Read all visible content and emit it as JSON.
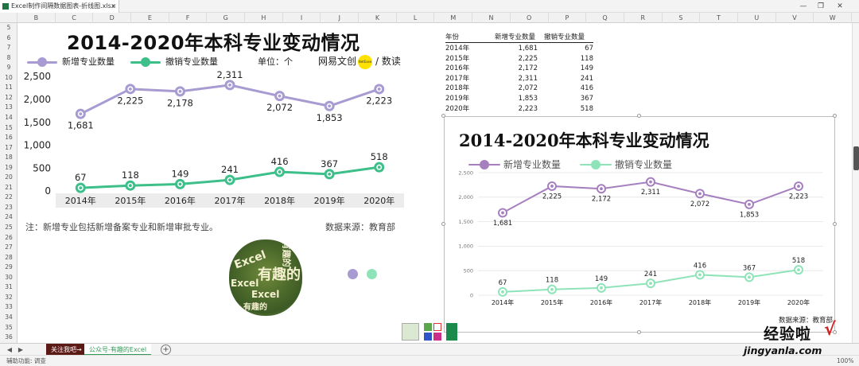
{
  "window": {
    "tab_title": "Excel制作间隔数据图表-折线图.xlsx",
    "tab_close": "×",
    "controls": {
      "minimize": "—",
      "restore": "❐",
      "close": "✕"
    }
  },
  "columns": [
    "B",
    "C",
    "D",
    "E",
    "F",
    "G",
    "H",
    "I",
    "J",
    "K",
    "L",
    "M",
    "N",
    "O",
    "P",
    "Q",
    "R",
    "S",
    "T",
    "U",
    "V",
    "W"
  ],
  "rows": [
    "5",
    "6",
    "7",
    "8",
    "9",
    "10",
    "11",
    "12",
    "13",
    "14",
    "15",
    "16",
    "17",
    "18",
    "19",
    "20",
    "21",
    "22",
    "23",
    "24",
    "25",
    "26",
    "27",
    "28",
    "29",
    "30",
    "31",
    "32",
    "33",
    "34",
    "35",
    "36"
  ],
  "left_chart": {
    "title": "2014-2020年本科专业变动情况",
    "legend": [
      {
        "label": "新增专业数量",
        "color": "#a79bd2"
      },
      {
        "label": "撤销专业数量",
        "color": "#3dbf8a"
      }
    ],
    "unit": "单位：个",
    "brand": {
      "text": "网易文创",
      "badge": "NetEase",
      "suffix": "/ 数读"
    },
    "note": "注：新增专业包括新增备案专业和新增审批专业。",
    "source": "数据来源：教育部"
  },
  "table": {
    "headers": [
      "年份",
      "新增专业数量",
      "撤销专业数量"
    ],
    "rows": [
      [
        "2014年",
        "1,681",
        "67"
      ],
      [
        "2015年",
        "2,225",
        "118"
      ],
      [
        "2016年",
        "2,172",
        "149"
      ],
      [
        "2017年",
        "2,311",
        "241"
      ],
      [
        "2018年",
        "2,072",
        "416"
      ],
      [
        "2019年",
        "1,853",
        "367"
      ],
      [
        "2020年",
        "2,223",
        "518"
      ]
    ]
  },
  "right_chart": {
    "title": "2014-2020年本科专业变动情况",
    "legend": [
      {
        "label": "新增专业数量",
        "color": "#a67fbf"
      },
      {
        "label": "撤销专业数量",
        "color": "#8fe3b8"
      }
    ],
    "source": "数据来源：教育部"
  },
  "word_cloud": {
    "words": [
      "Excel",
      "有趣的",
      "Excel",
      "有趣的",
      "Excel",
      "有趣的"
    ]
  },
  "sheets": [
    {
      "label": "关注我吧→",
      "active": false,
      "color": "#5b1a16"
    },
    {
      "label": "公众号-有趣的Excel",
      "active": true,
      "color": "#2f9a56"
    }
  ],
  "sheet_add": "+",
  "status": {
    "left": "辅助功能: 调查",
    "zoom": "100%"
  },
  "watermark": {
    "cn": "经验啦",
    "check": "√",
    "url": "jingyanla.com"
  },
  "chart_data": [
    {
      "type": "line",
      "title": "2014-2020年本科专业变动情况",
      "categories": [
        "2014年",
        "2015年",
        "2016年",
        "2017年",
        "2018年",
        "2019年",
        "2020年"
      ],
      "series": [
        {
          "name": "新增专业数量",
          "values": [
            1681,
            2225,
            2172,
            2311,
            2072,
            1853,
            2223
          ],
          "labels": [
            "1,681",
            "2,225",
            "2,178",
            "2,311",
            "2,072",
            "1,853",
            "2,223"
          ]
        },
        {
          "name": "撤销专业数量",
          "values": [
            67,
            118,
            149,
            241,
            416,
            367,
            518
          ],
          "labels": [
            "67",
            "118",
            "149",
            "241",
            "416",
            "367",
            "518"
          ]
        }
      ],
      "ylim": [
        0,
        2500
      ],
      "yticks": [
        "0",
        "500",
        "1,000",
        "1,500",
        "2,000",
        "2,500"
      ],
      "grid": false,
      "legend": "top-left"
    },
    {
      "type": "line",
      "title": "2014-2020年本科专业变动情况",
      "categories": [
        "2014年",
        "2015年",
        "2016年",
        "2017年",
        "2018年",
        "2019年",
        "2020年"
      ],
      "series": [
        {
          "name": "新增专业数量",
          "values": [
            1681,
            2225,
            2172,
            2311,
            2072,
            1853,
            2223
          ],
          "labels": [
            "1,681",
            "2,225",
            "2,172",
            "2,311",
            "2,072",
            "1,853",
            "2,223"
          ]
        },
        {
          "name": "撤销专业数量",
          "values": [
            67,
            118,
            149,
            241,
            416,
            367,
            518
          ],
          "labels": [
            "67",
            "118",
            "149",
            "241",
            "416",
            "367",
            "518"
          ]
        }
      ],
      "ylim": [
        0,
        2500
      ],
      "yticks": [
        "0",
        "500",
        "1,000",
        "1,500",
        "2,000",
        "2,500"
      ],
      "grid": true,
      "legend": "top-left"
    }
  ]
}
